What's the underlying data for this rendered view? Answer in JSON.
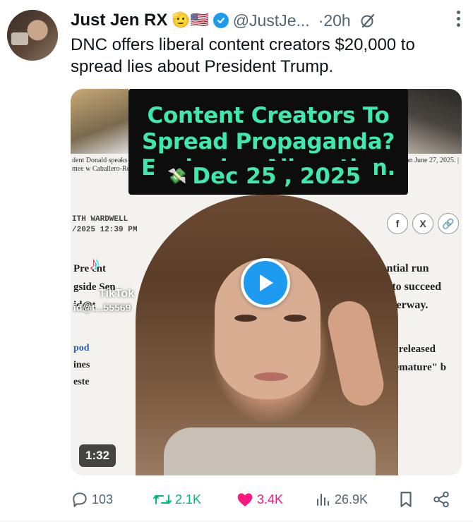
{
  "author": {
    "display_name": "Just Jen RX",
    "name_emojis": "🫡🇺🇸",
    "handle": "@JustJe...",
    "time": "·20h"
  },
  "tweet": {
    "text": "DNC offers liberal content creators $20,000 to spread lies about President Trump."
  },
  "media": {
    "overlay_lines": [
      "Content Creators To",
      "Spread Propaganda?",
      "Explosive Allegation."
    ],
    "overlay_date": "Dec 25 , 2025",
    "duration": "1:32",
    "tiktok_label": "TikTok",
    "tiktok_id": "id@t...55569",
    "article": {
      "caption_left": "dent Donald speaks during a mee w Caballero-Reynold",
      "caption_right": "Marco Rubio, n on June 27, 2025. |",
      "byline_1": "ITH WARDWELL",
      "byline_2": "/2025 12:39 PM",
      "left_text": [
        "Pre  ent",
        "gside Sen",
        "id@t"
      ],
      "right_text": [
        "2028 presidential run",
        "rly jockeying to succeed",
        "Party gets underway."
      ],
      "left_text_2": [
        "pod",
        "ines",
        "este"
      ],
      "right_text_2": [
        "One\" released",
        "s \"premature\" b"
      ]
    },
    "share_icons": [
      "f",
      "X",
      "🔗"
    ]
  },
  "actions": {
    "replies": "103",
    "reposts": "2.1K",
    "likes": "3.4K",
    "views": "26.9K"
  },
  "colors": {
    "accent": "#1d9bf0",
    "overlay_text": "#3ee8b0",
    "repost_green": "#00ba7c",
    "like_pink": "#f91880",
    "muted": "#536471"
  }
}
